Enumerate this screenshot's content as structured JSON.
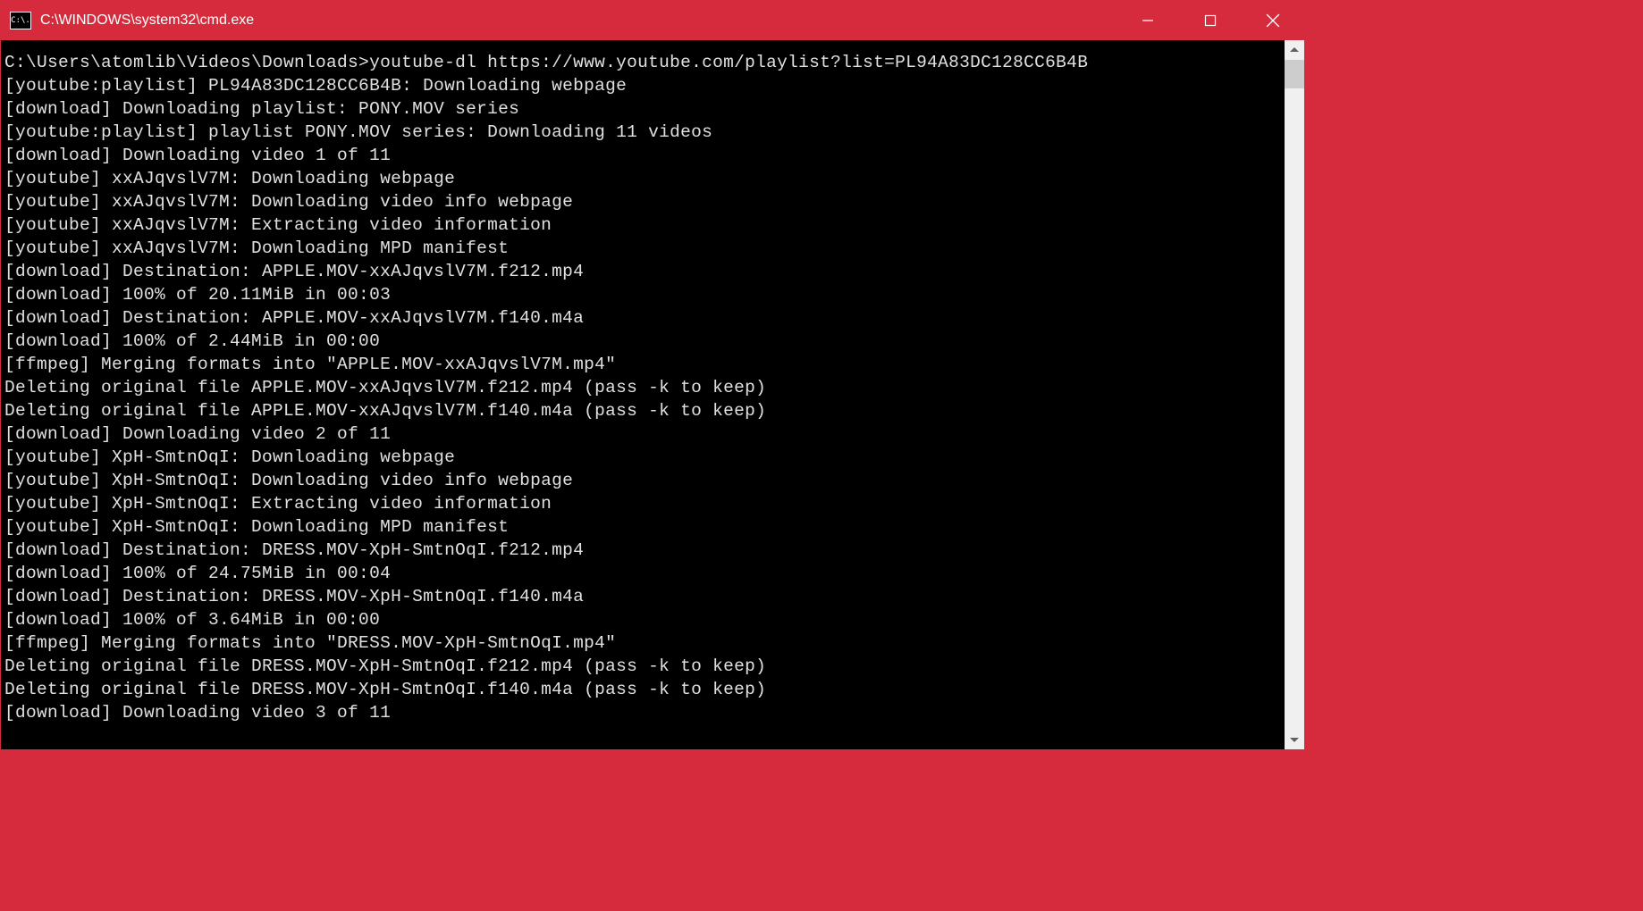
{
  "window": {
    "title": "C:\\WINDOWS\\system32\\cmd.exe",
    "icon_text": "C:\\."
  },
  "terminal": {
    "lines": [
      "C:\\Users\\atomlib\\Videos\\Downloads>youtube-dl https://www.youtube.com/playlist?list=PL94A83DC128CC6B4B",
      "[youtube:playlist] PL94A83DC128CC6B4B: Downloading webpage",
      "[download] Downloading playlist: PONY.MOV series",
      "[youtube:playlist] playlist PONY.MOV series: Downloading 11 videos",
      "[download] Downloading video 1 of 11",
      "[youtube] xxAJqvslV7M: Downloading webpage",
      "[youtube] xxAJqvslV7M: Downloading video info webpage",
      "[youtube] xxAJqvslV7M: Extracting video information",
      "[youtube] xxAJqvslV7M: Downloading MPD manifest",
      "[download] Destination: APPLE.MOV-xxAJqvslV7M.f212.mp4",
      "[download] 100% of 20.11MiB in 00:03",
      "[download] Destination: APPLE.MOV-xxAJqvslV7M.f140.m4a",
      "[download] 100% of 2.44MiB in 00:00",
      "[ffmpeg] Merging formats into \"APPLE.MOV-xxAJqvslV7M.mp4\"",
      "Deleting original file APPLE.MOV-xxAJqvslV7M.f212.mp4 (pass -k to keep)",
      "Deleting original file APPLE.MOV-xxAJqvslV7M.f140.m4a (pass -k to keep)",
      "[download] Downloading video 2 of 11",
      "[youtube] XpH-SmtnOqI: Downloading webpage",
      "[youtube] XpH-SmtnOqI: Downloading video info webpage",
      "[youtube] XpH-SmtnOqI: Extracting video information",
      "[youtube] XpH-SmtnOqI: Downloading MPD manifest",
      "[download] Destination: DRESS.MOV-XpH-SmtnOqI.f212.mp4",
      "[download] 100% of 24.75MiB in 00:04",
      "[download] Destination: DRESS.MOV-XpH-SmtnOqI.f140.m4a",
      "[download] 100% of 3.64MiB in 00:00",
      "[ffmpeg] Merging formats into \"DRESS.MOV-XpH-SmtnOqI.mp4\"",
      "Deleting original file DRESS.MOV-XpH-SmtnOqI.f212.mp4 (pass -k to keep)",
      "Deleting original file DRESS.MOV-XpH-SmtnOqI.f140.m4a (pass -k to keep)",
      "[download] Downloading video 3 of 11"
    ]
  }
}
